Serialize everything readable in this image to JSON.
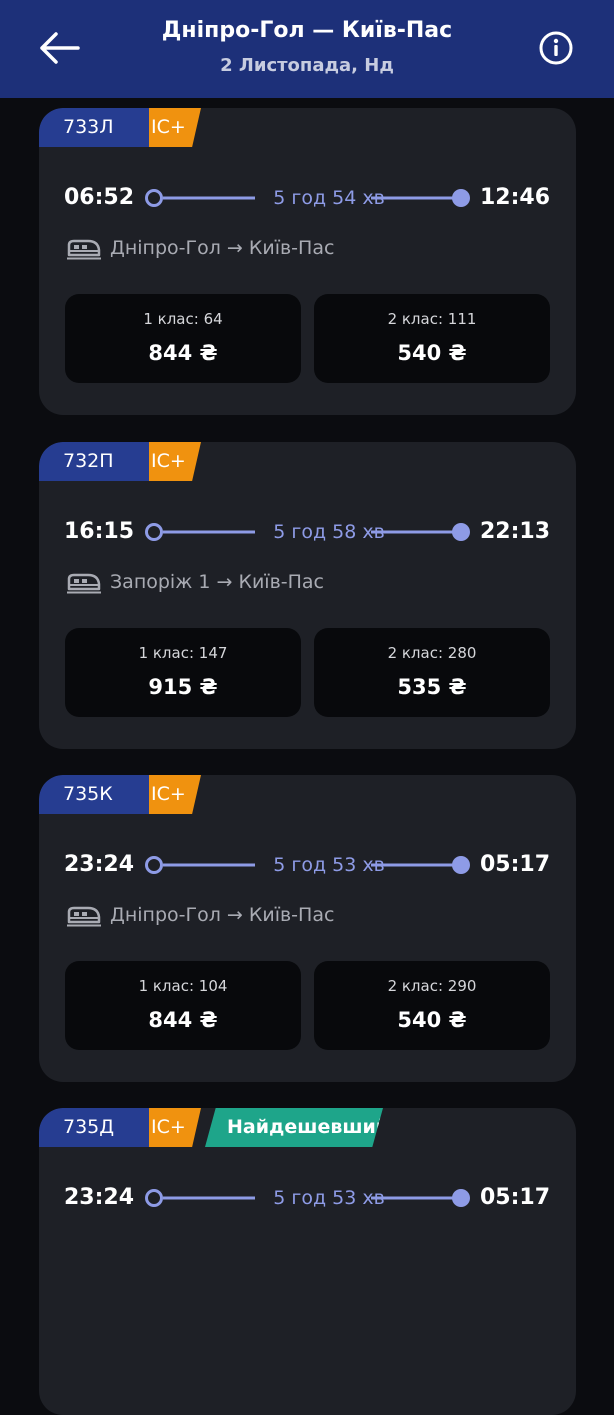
{
  "header": {
    "title": "Дніпро-Гол — Київ-Пас",
    "subtitle": "2 Листопада, Нд",
    "back_icon": "arrow-left-icon",
    "info_icon": "info-circle-icon",
    "background_color": "#1d3079"
  },
  "colors": {
    "train_number_badge": "#263d91",
    "ic_badge": "#f0920f",
    "cheapest_badge": "#1ea58a",
    "timeline_accent": "#8e9be6"
  },
  "trains": [
    {
      "number": "733Л",
      "type": "IC+",
      "departure": "06:52",
      "arrival": "12:46",
      "duration": "5 год 54 хв",
      "route": "Дніпро-Гол → Київ-Пас",
      "classes": [
        {
          "label": "1 клас: 64",
          "price": "844 ₴"
        },
        {
          "label": "2 клас: 111",
          "price": "540 ₴"
        }
      ]
    },
    {
      "number": "732П",
      "type": "IC+",
      "departure": "16:15",
      "arrival": "22:13",
      "duration": "5 год 58 хв",
      "route": "Запоріж 1 → Київ-Пас",
      "classes": [
        {
          "label": "1 клас: 147",
          "price": "915 ₴"
        },
        {
          "label": "2 клас: 280",
          "price": "535 ₴"
        }
      ]
    },
    {
      "number": "735К",
      "type": "IC+",
      "departure": "23:24",
      "arrival": "05:17",
      "duration": "5 год 53 хв",
      "route": "Дніпро-Гол → Київ-Пас",
      "classes": [
        {
          "label": "1 клас: 104",
          "price": "844 ₴"
        },
        {
          "label": "2 клас: 290",
          "price": "540 ₴"
        }
      ]
    },
    {
      "number": "735Д",
      "type": "IC+",
      "tag": "Найдешевший",
      "departure": "23:24",
      "arrival": "05:17",
      "duration": "5 год 53 хв"
    }
  ]
}
